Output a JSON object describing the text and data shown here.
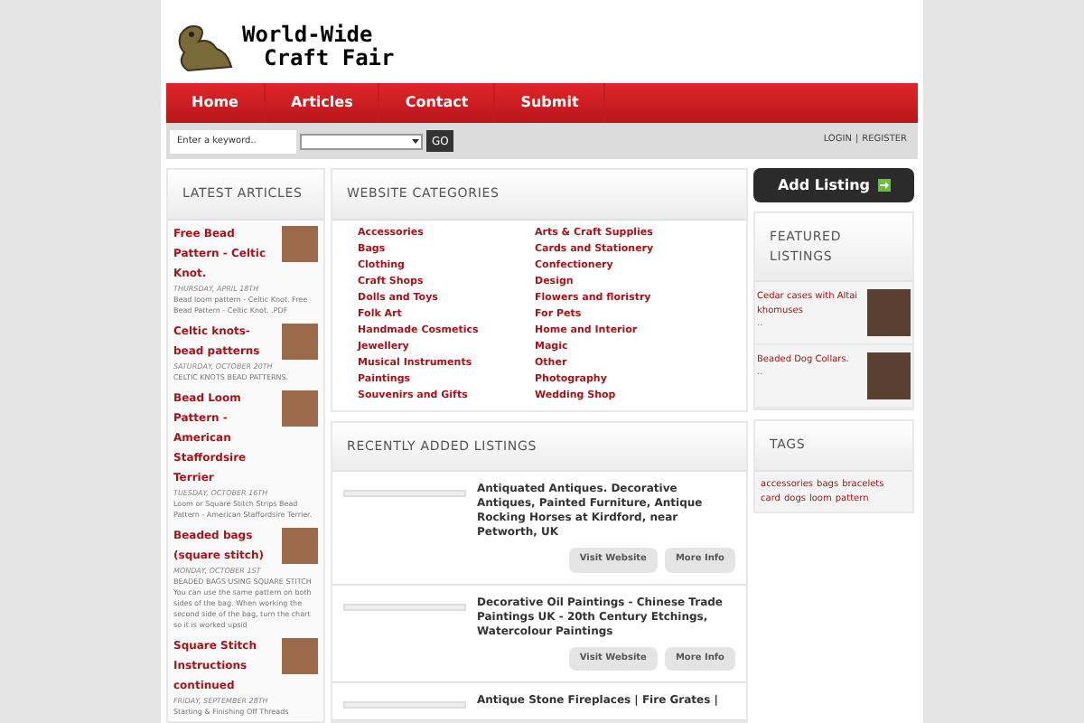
{
  "logo": {
    "line_1": "World-Wide",
    "line_2": "Craft Fair"
  },
  "nav": [
    {
      "label": "Home",
      "selected": false
    },
    {
      "label": "Articles",
      "selected": false
    },
    {
      "label": "Contact",
      "selected": false
    },
    {
      "label": "Submit",
      "selected": false
    }
  ],
  "search": {
    "placeholder": "Enter a keyword..",
    "button": "GO"
  },
  "auth": {
    "login": "LOGIN",
    "separator": "|",
    "register": "REGISTER"
  },
  "latest_articles": {
    "title": "LATEST ARTICLES",
    "items": [
      {
        "title": "Free Bead Pattern - Celtic Knot.",
        "date": "THURSDAY, APRIL 18TH",
        "excerpt": "Bead loom pattern - Celtic Knot. Free Bead Pattern - Celtic Knot. .PDF"
      },
      {
        "title": "Celtic knots-bead patterns",
        "date": "SATURDAY, OCTOBER 20TH",
        "excerpt": "CELTIC KNOTS BEAD PATTERNS."
      },
      {
        "title": "Bead Loom Pattern - American Staffordsire Terrier",
        "date": "TUESDAY, OCTOBER 16TH",
        "excerpt": "Loom or Square Stitch Strips Bead Pattern - American Staffordsire Terrier."
      },
      {
        "title": "Beaded bags (square stitch)",
        "date": "MONDAY, OCTOBER 1ST",
        "excerpt": "BEADED BAGS USING SQUARE STITCH You can use the same pattern on both sides of the bag. When working the second side of the bag, turn the chart so it is worked upsid"
      },
      {
        "title": "Square Stitch Instructions continued",
        "date": "FRIDAY, SEPTEMBER 28TH",
        "excerpt": "Starting & Finishing Off Threads"
      }
    ]
  },
  "categories": {
    "title": "WEBSITE CATEGORIES",
    "column_1": [
      "Accessories",
      "Bags",
      "Clothing",
      "Craft Shops",
      "Dolls and Toys",
      "Folk Art",
      "Handmade Cosmetics",
      "Jewellery",
      "Musical Instruments",
      "Paintings",
      "Souvenirs and Gifts"
    ],
    "column_2": [
      "Arts & Craft Supplies",
      "Cards and Stationery",
      "Confectionery",
      "Design",
      "Flowers and floristry",
      "For Pets",
      "Home and Interior",
      "Magic",
      "Other",
      "Photography",
      "Wedding Shop"
    ]
  },
  "recent_listings": {
    "title": "RECENTLY ADDED LISTINGS",
    "items": [
      {
        "title": "Antiquated Antiques. Decorative Antiques, Painted Furniture, Antique Rocking Horses at Kirdford, near Petworth, UK",
        "buttons": [
          "Visit Website",
          "More Info"
        ]
      },
      {
        "title": "Decorative Oil Paintings - Chinese Trade Paintings UK - 20th Century Etchings, Watercolour Paintings",
        "buttons": [
          "Visit Website",
          "More Info"
        ]
      },
      {
        "title": "Antique Stone Fireplaces | Fire Grates |"
      }
    ]
  },
  "add_listing": "Add Listing",
  "featured": {
    "title": "FEATURED LISTINGS",
    "items": [
      {
        "title": "Cedar cases with Altai khomuses",
        "more": ".."
      },
      {
        "title": "Beaded Dog Collars.",
        "more": ".."
      }
    ]
  },
  "tags": {
    "title": "TAGS",
    "items": [
      "accessories",
      "bags",
      "bracelets",
      "card",
      "dogs",
      "loom",
      "pattern"
    ]
  }
}
